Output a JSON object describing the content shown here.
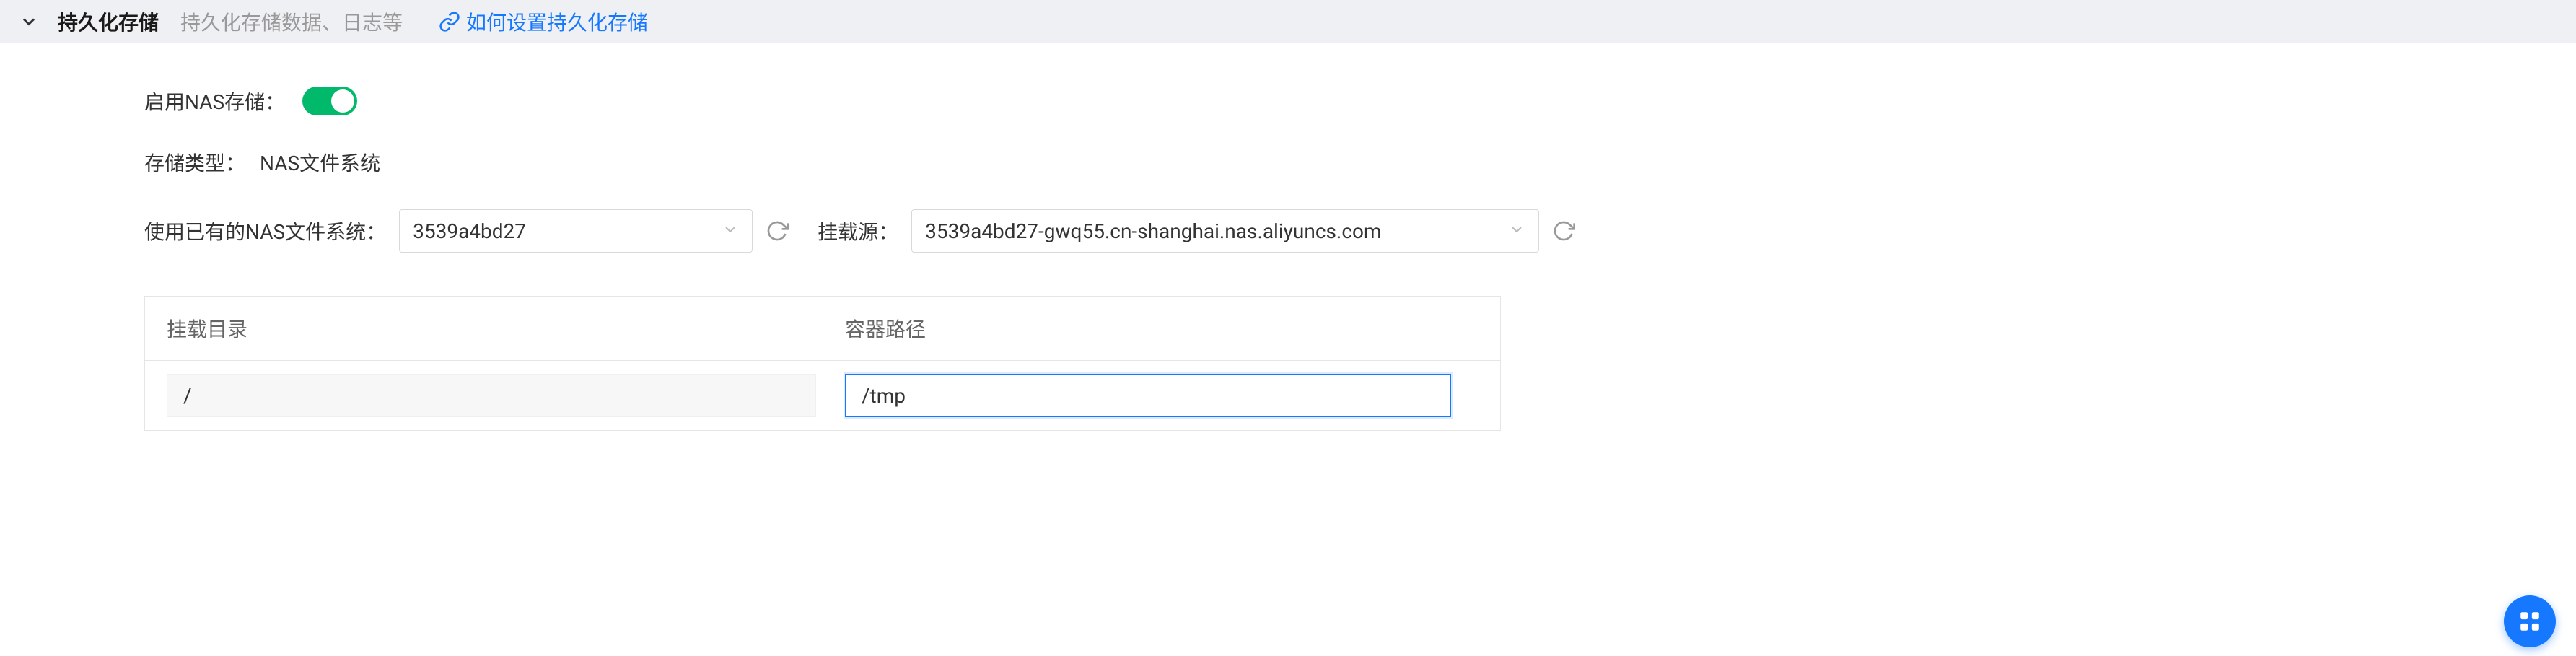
{
  "header": {
    "title": "持久化存储",
    "subtitle": "持久化存储数据、日志等",
    "help_link": "如何设置持久化存储"
  },
  "form": {
    "enable_nas_label": "启用NAS存储：",
    "enable_nas_on": true,
    "storage_type_label": "存储类型：",
    "storage_type_value": "NAS文件系统",
    "use_existing_nas_label": "使用已有的NAS文件系统：",
    "nas_selected": "3539a4bd27",
    "mount_source_label": "挂载源：",
    "mount_source_selected": "3539a4bd27-gwq55.cn-shanghai.nas.aliyuncs.com"
  },
  "table": {
    "columns": {
      "mount_dir": "挂载目录",
      "container_path": "容器路径"
    },
    "rows": [
      {
        "mount_dir": "/",
        "container_path": "/tmp"
      }
    ]
  }
}
